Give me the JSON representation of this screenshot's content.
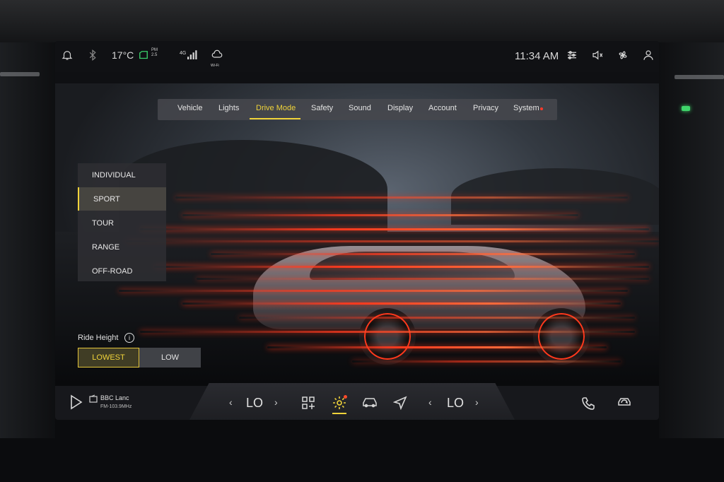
{
  "status_bar": {
    "temperature": "17°C",
    "pm_label_top": "PM",
    "pm_label_bottom": "2.5",
    "network": "4G",
    "wifi_label": "Wi-Fi",
    "time": "11:34 AM"
  },
  "tabs": [
    {
      "label": "Vehicle"
    },
    {
      "label": "Lights"
    },
    {
      "label": "Drive Mode",
      "active": true
    },
    {
      "label": "Safety"
    },
    {
      "label": "Sound"
    },
    {
      "label": "Display"
    },
    {
      "label": "Account"
    },
    {
      "label": "Privacy"
    },
    {
      "label": "System"
    }
  ],
  "drive_modes": [
    {
      "label": "INDIVIDUAL"
    },
    {
      "label": "SPORT",
      "active": true
    },
    {
      "label": "TOUR"
    },
    {
      "label": "RANGE"
    },
    {
      "label": "OFF-ROAD"
    }
  ],
  "ride_height": {
    "label": "Ride Height",
    "info": "i",
    "options": [
      {
        "label": "LOWEST",
        "active": true
      },
      {
        "label": "LOW"
      }
    ]
  },
  "dock": {
    "radio_station": "BBC Lanc",
    "radio_frequency": "FM-103.9MHz",
    "climate_left": "LO",
    "climate_right": "LO",
    "chevron_left": "‹",
    "chevron_right": "›"
  },
  "colors": {
    "accent": "#f0d33a",
    "alert": "#ff3a2a",
    "streak": "#ff3a1e"
  }
}
